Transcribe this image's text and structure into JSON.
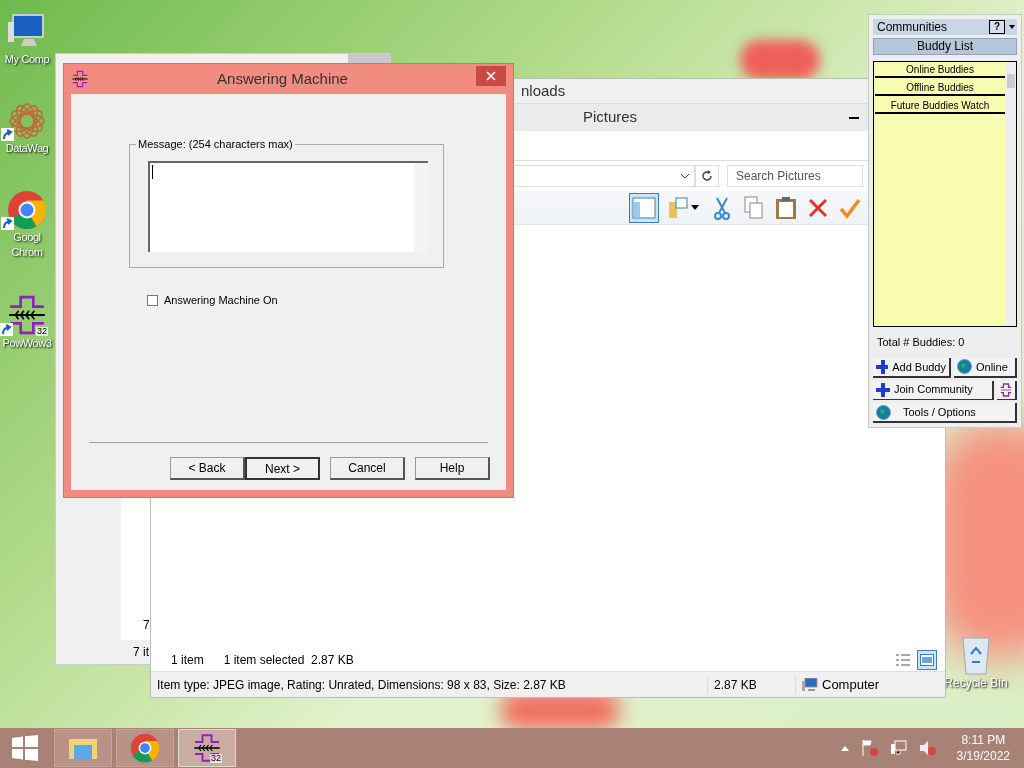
{
  "desktop_icons": [
    {
      "label": "My Comp",
      "kind": "computer",
      "shortcut": false
    },
    {
      "label": "DataWag",
      "kind": "datawag",
      "shortcut": true
    },
    {
      "label": "Googl Chrom",
      "kind": "chrome",
      "shortcut": true
    },
    {
      "label": "PowWow3",
      "kind": "powwow",
      "shortcut": true,
      "badge": "32"
    }
  ],
  "recycle_bin": {
    "label": "Recycle Bin"
  },
  "back_window": {
    "line_fragment": "7",
    "status": "7 it"
  },
  "explorer": {
    "title": "nloads",
    "subtitle": "Pictures",
    "search": {
      "placeholder": "Search Pictures"
    },
    "toolbar": [
      {
        "kind": "pane",
        "selected": true
      },
      {
        "kind": "folder",
        "selected": false
      },
      {
        "kind": "cut",
        "selected": false
      },
      {
        "kind": "copy",
        "selected": false
      },
      {
        "kind": "paste",
        "selected": false
      },
      {
        "kind": "delete",
        "selected": false
      },
      {
        "kind": "check",
        "selected": false
      }
    ],
    "item_count": "1 item",
    "selection": "1 item selected  2.87 KB",
    "views": [
      {
        "kind": "details",
        "selected": false
      },
      {
        "kind": "preview",
        "selected": true
      }
    ],
    "details": "Item type: JPEG image, Rating: Unrated, Dimensions: 98 x 83, Size: 2.87 KB",
    "size": "2.87 KB",
    "zone": "Computer"
  },
  "dialog": {
    "title": "Answering Machine",
    "group_label": "Message: (254 characters max)",
    "checkbox": {
      "label": "Answering Machine On",
      "checked": false
    },
    "buttons": [
      {
        "label": "< Back",
        "default": false
      },
      {
        "label": "Next >",
        "default": true
      },
      {
        "label": "Cancel",
        "default": false
      },
      {
        "label": "Help",
        "default": false
      }
    ]
  },
  "buddy_panel": {
    "header": "Communities",
    "help": "?",
    "title": "Buddy List",
    "groups": [
      "Online Buddies",
      "Offline Buddies",
      "Future Buddies Watch"
    ],
    "total": "Total # Buddies: 0",
    "button_rows": [
      [
        {
          "label": "Add Buddy",
          "kind": "plus"
        },
        {
          "label": "Online",
          "kind": "globe"
        }
      ],
      [
        {
          "label": "Join Community",
          "kind": "plus"
        },
        {
          "kind": "powwow"
        }
      ],
      [
        {
          "label": "Tools / Options",
          "kind": "globe"
        }
      ]
    ]
  },
  "taskbar": {
    "apps": [
      {
        "kind": "explorer",
        "selected": false
      },
      {
        "kind": "chrome",
        "selected": false
      },
      {
        "kind": "powwow",
        "selected": true,
        "badge": "32"
      }
    ],
    "time": "8:11 PM",
    "date": "3/19/2022"
  }
}
